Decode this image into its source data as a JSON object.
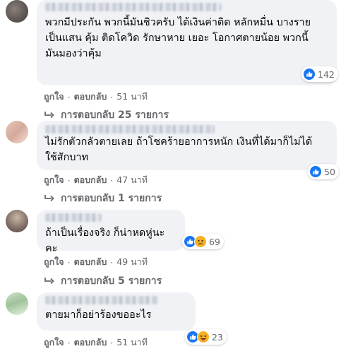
{
  "comments": [
    {
      "text": "พวกมีประกัน พวกนี้มันชิวครับ ได้เงินค่าติด หลักหมื่น บางราย เป็นแสน คุ้ม ติดโควิด รักษาหาย เยอะ โอกาศตายน้อย พวกนี้มันมองว่าคุ้ม",
      "line1": "พวกมีประกัน พวกนี้มันชิวครับ ได้เงินค่าติด หลักหมื่น บางราย",
      "line2": "เป็นแสน คุ้ม ติดโควิด รักษาหาย เยอะ โอกาศตายน้อย พวกนี้",
      "line3": "มันมองว่าคุ้ม",
      "reaction_count": "142",
      "like": "ถูกใจ",
      "reply": "ตอบกลับ",
      "time": "51 นาที",
      "replies_label": "การตอบกลับ 25 รายการ"
    },
    {
      "line1": "ไม่รักตัวกลัวตายเลย ถ้าโชคร้ายอาการหนัก เงินที่ได้มาก็ไม่ได้",
      "line2": "ใช้สักบาท",
      "reaction_count": "50",
      "like": "ถูกใจ",
      "reply": "ตอบกลับ",
      "time": "47 นาที",
      "replies_label": "การตอบกลับ 1 รายการ"
    },
    {
      "line1": "ถ้าเป็นเรื่องจริง ก็น่าหดหู่นะคะ",
      "reaction_count": "69",
      "like": "ถูกใจ",
      "reply": "ตอบกลับ",
      "time": "49 นาที",
      "replies_label": "การตอบกลับ 5 รายการ"
    },
    {
      "line1": "ตายมาก็อย่าร้องขออะไร",
      "reaction_count": "23",
      "like": "ถูกใจ",
      "reply": "ตอบกลับ",
      "time": "51 นาที"
    }
  ],
  "colors": {
    "like": "#1877f2",
    "secondary_text": "#65676b",
    "bubble": "#f0f2f5",
    "emoji_yellow": "#f7b125"
  },
  "icons": [
    "like-icon",
    "sad-icon",
    "haha-icon",
    "reply-arrow-icon"
  ]
}
